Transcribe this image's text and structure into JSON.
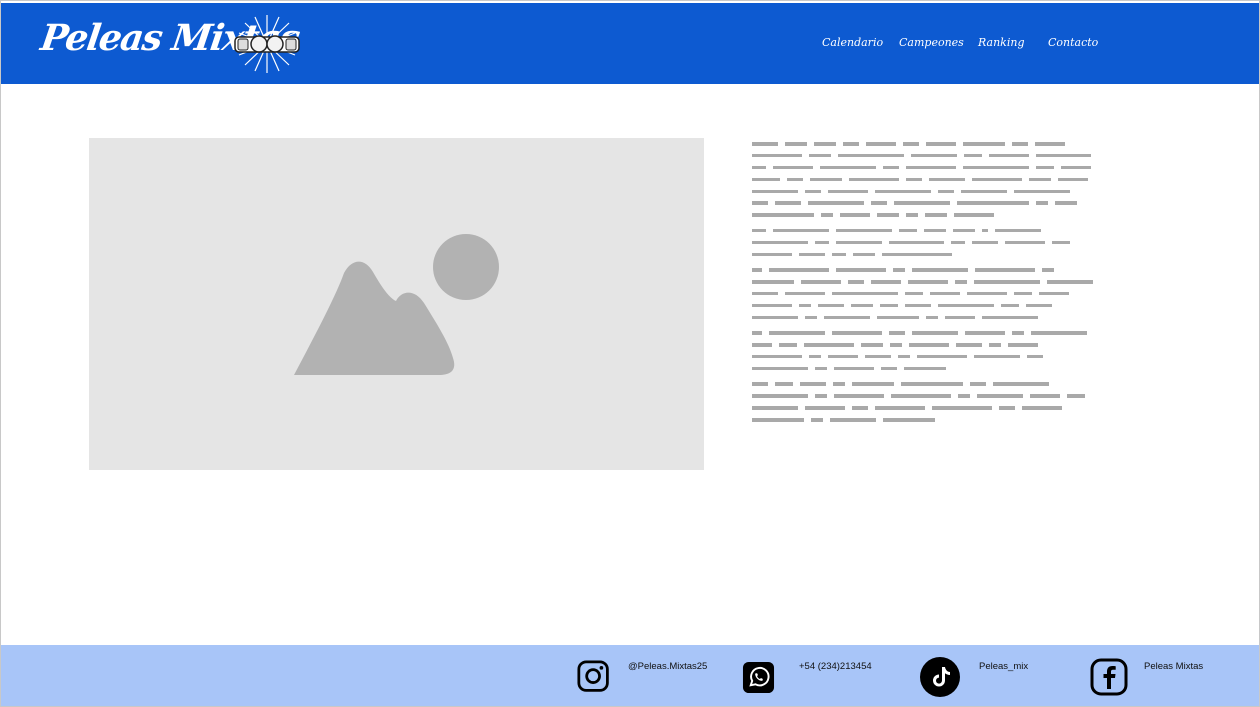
{
  "brand": {
    "name": "Peleas Mixtas",
    "emblem_icon": "boxing-gloves-emblem"
  },
  "nav": {
    "items": [
      {
        "label": "Calendario"
      },
      {
        "label": "Campeones"
      },
      {
        "label": "Ranking"
      },
      {
        "label": "Contacto"
      }
    ]
  },
  "main": {
    "image_placeholder_icon": "image-placeholder-icon",
    "paragraphs": [
      [
        [
          26,
          22,
          22,
          16,
          30,
          16,
          30,
          42,
          16,
          30
        ],
        [
          50,
          22,
          66,
          46,
          18,
          40,
          55
        ],
        [
          14,
          40,
          56,
          16,
          50,
          66,
          18,
          30
        ],
        [
          28,
          16,
          32,
          50,
          16,
          36,
          50,
          22,
          30
        ],
        [
          46,
          16,
          40,
          56,
          16,
          46,
          56
        ],
        [
          16,
          26,
          56,
          16,
          56,
          72,
          12,
          22
        ],
        [
          62,
          12,
          30,
          22,
          12,
          22,
          40
        ]
      ],
      [
        [
          14,
          56,
          56,
          18,
          22,
          22,
          6,
          46
        ],
        [
          56,
          14,
          46,
          55,
          14,
          26,
          40,
          18
        ],
        [
          40,
          26,
          14,
          22,
          70
        ]
      ],
      [
        [
          10,
          60,
          50,
          12,
          56,
          60,
          12
        ],
        [
          42,
          40,
          16,
          30,
          40,
          12,
          66,
          46
        ],
        [
          26,
          40,
          66,
          18,
          30,
          40,
          18,
          30
        ],
        [
          40,
          12,
          26,
          22,
          18,
          26,
          56,
          18,
          26
        ],
        [
          46,
          12,
          46,
          42,
          12,
          30,
          56
        ]
      ],
      [
        [
          10,
          56,
          50,
          16,
          46,
          40,
          12,
          56
        ],
        [
          20,
          18,
          50,
          22,
          12,
          40,
          26,
          12,
          30
        ],
        [
          50,
          12,
          30,
          26,
          12,
          50,
          46,
          16
        ],
        [
          56,
          12,
          40,
          16,
          42
        ]
      ],
      [
        [
          16,
          18,
          26,
          12,
          42,
          62,
          16,
          56
        ],
        [
          56,
          12,
          50,
          60,
          12,
          46,
          30,
          18
        ],
        [
          46,
          40,
          16,
          50,
          60,
          16,
          40
        ],
        [
          52,
          12,
          46,
          52
        ]
      ]
    ]
  },
  "footer": {
    "socials": [
      {
        "icon": "instagram-icon",
        "label": "@Peleas.Mixtas25"
      },
      {
        "icon": "whatsapp-icon",
        "label": "+54 (234)213454"
      },
      {
        "icon": "tiktok-icon",
        "label": "Peleas_mix"
      },
      {
        "icon": "facebook-icon",
        "label": "Peleas Mixtas"
      }
    ]
  },
  "colors": {
    "header_bg": "#0d5ad1",
    "footer_bg": "#a8c5f8",
    "placeholder_bg": "#e5e5e5",
    "placeholder_glyph": "#b2b2b2",
    "text_line": "#a9a9a9"
  }
}
